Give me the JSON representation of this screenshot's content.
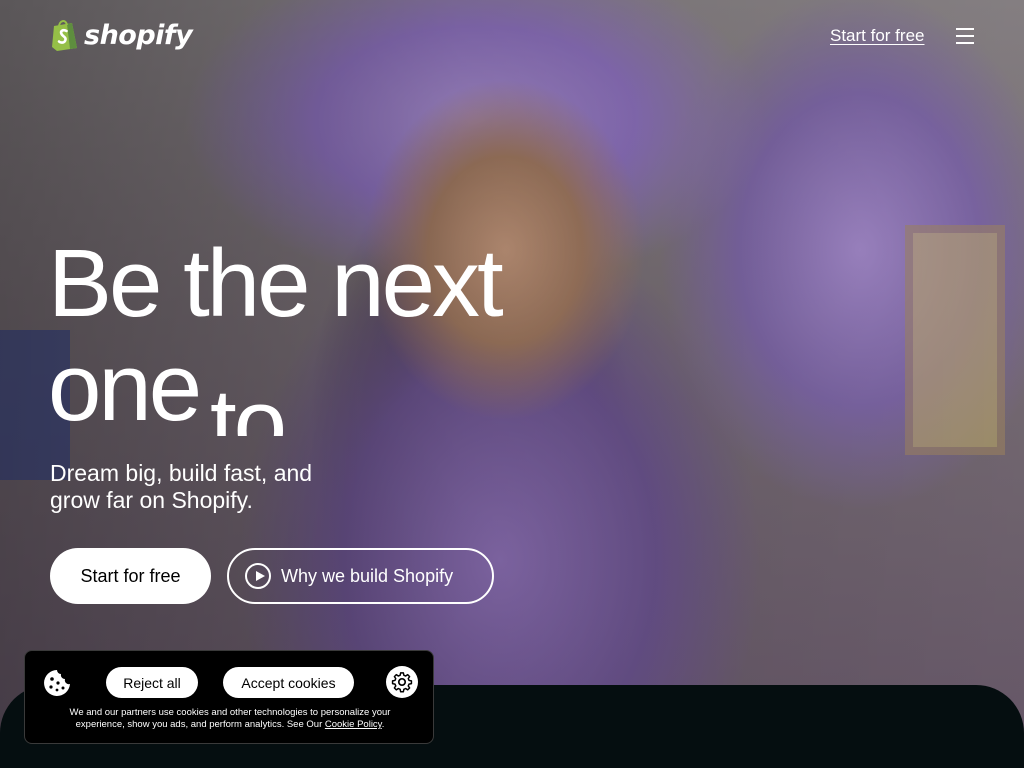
{
  "header": {
    "logo_text": "shopify",
    "cta_label": "Start for free",
    "menu_icon": "hamburger-menu-icon"
  },
  "hero": {
    "headline_line1": "Be the next",
    "headline_line2": "one",
    "headline_partial_word": "to",
    "subtitle": "Dream big, build fast, and grow far on Shopify.",
    "primary_button": "Start for free",
    "secondary_button": "Why we build Shopify",
    "secondary_icon": "play-icon"
  },
  "cookie_banner": {
    "reject_label": "Reject all",
    "accept_label": "Accept cookies",
    "text": "We and our partners use cookies and other technologies to personalize your experience, show you ads, and perform analytics. See Our ",
    "link_label": "Cookie Policy",
    "text_end": ".",
    "cookie_icon": "cookie-icon",
    "settings_icon": "gear-icon"
  },
  "colors": {
    "brand_green": "#95bf47",
    "dark_section": "#050e10",
    "button_bg": "#ffffff"
  }
}
